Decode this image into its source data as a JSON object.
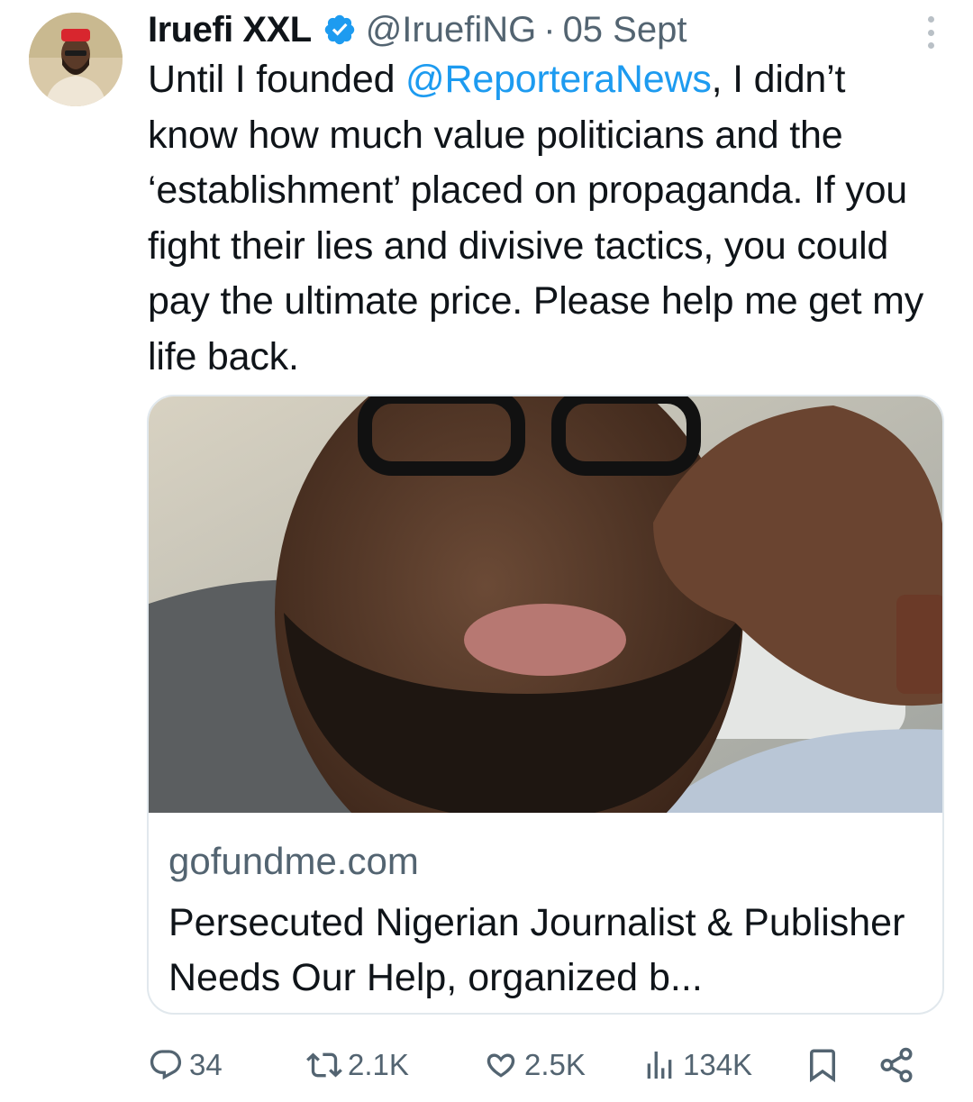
{
  "tweet": {
    "author_name": "Iruefi XXL",
    "handle": "@IruefiNG",
    "separator": "·",
    "date": "05 Sept",
    "text_before_mention": "Until I founded ",
    "mention": "@ReporteraNews",
    "text_after_mention": ", I didn’t know how much value politicians and the ‘establishment’ placed on propaganda. If you fight their lies and divisive tactics, you could pay the ultimate price. Please help me get my life back."
  },
  "link_card": {
    "domain": "gofundme.com",
    "title": "Persecuted Nigerian Journalist & Publisher Needs Our Help, organized b..."
  },
  "actions": {
    "replies": "34",
    "reposts": "2.1K",
    "likes": "2.5K",
    "views": "134K"
  },
  "colors": {
    "accent": "#1d9bf0",
    "secondary_text": "#536471",
    "border": "#e1e8ed"
  },
  "icons": [
    "verified-badge-icon",
    "more-options-icon",
    "reply-icon",
    "repost-icon",
    "like-icon",
    "views-icon",
    "bookmark-icon",
    "share-icon"
  ]
}
